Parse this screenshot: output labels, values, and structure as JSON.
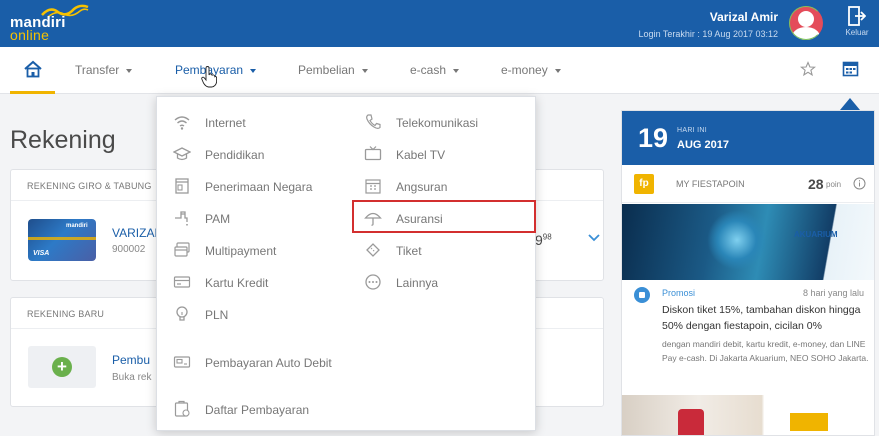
{
  "brand": {
    "name": "mandiri",
    "sub": "online"
  },
  "user": {
    "name": "Varizal Amir",
    "last_login": "Login Terakhir : 19 Aug 2017 03:12"
  },
  "logout_label": "Keluar",
  "nav": {
    "items": [
      {
        "label": "Transfer",
        "active": false
      },
      {
        "label": "Pembayaran",
        "active": true
      },
      {
        "label": "Pembelian",
        "active": false
      },
      {
        "label": "e-cash",
        "active": false
      },
      {
        "label": "e-money",
        "active": false
      }
    ]
  },
  "main": {
    "title": "Rekening",
    "giro_card": {
      "header": "REKENING GIRO & TABUNG",
      "account_name": "VARIZAL",
      "account_number": "900002",
      "balance": "9",
      "balance_cents": "98"
    },
    "new_card": {
      "header": "REKENING BARU",
      "title": "Pembu",
      "subtitle": "Buka rek"
    }
  },
  "dropdown": {
    "left": [
      {
        "label": "Internet",
        "icon": "wifi-icon"
      },
      {
        "label": "Pendidikan",
        "icon": "graduation-cap-icon"
      },
      {
        "label": "Penerimaan Negara",
        "icon": "document-icon"
      },
      {
        "label": "PAM",
        "icon": "water-tap-icon"
      },
      {
        "label": "Multipayment",
        "icon": "multipayment-icon"
      },
      {
        "label": "Kartu Kredit",
        "icon": "credit-card-icon"
      },
      {
        "label": "PLN",
        "icon": "lightbulb-icon"
      },
      {
        "label": "Pembayaran Auto Debit",
        "icon": "auto-debit-icon"
      },
      {
        "label": "Daftar Pembayaran",
        "icon": "payment-list-icon"
      }
    ],
    "right": [
      {
        "label": "Telekomunikasi",
        "icon": "phone-icon"
      },
      {
        "label": "Kabel TV",
        "icon": "tv-icon"
      },
      {
        "label": "Angsuran",
        "icon": "calendar-icon"
      },
      {
        "label": "Asuransi",
        "icon": "umbrella-icon"
      },
      {
        "label": "Tiket",
        "icon": "ticket-icon"
      },
      {
        "label": "Lainnya",
        "icon": "more-icon"
      }
    ]
  },
  "sidebar": {
    "date_day": "19",
    "date_small": "HARI INI",
    "date_month": "AUG 2017",
    "fiesta_badge": "fp",
    "fiesta_label": "MY FIESTAPOIN",
    "fiesta_points": "28",
    "fiesta_unit": "poin",
    "promo_logo": "AKUARIUM",
    "promo_category": "Promosi",
    "promo_ago": "8 hari yang lalu",
    "promo_title": "Diskon tiket 15%, tambahan diskon hingga 50% dengan fiestapoin, cicilan 0%",
    "promo_desc": "dengan mandiri debit, kartu kredit, e-money, dan LINE Pay e-cash. Di Jakarta Akuarium, NEO SOHO Jakarta."
  },
  "colors": {
    "primary": "#1a5ea8",
    "accent": "#f0b400",
    "highlight": "#d32f2f"
  }
}
